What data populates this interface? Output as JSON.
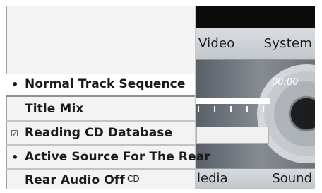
{
  "tabs_top": {
    "video": "Video",
    "system": "System"
  },
  "tabs_bottom": {
    "media": "ledia",
    "sound": "Sound"
  },
  "player": {
    "time": "00:00",
    "progress": 1.0
  },
  "menu": {
    "items": [
      {
        "marker": "•",
        "label": "Normal Track Sequence"
      },
      {
        "marker": "",
        "label": "Title Mix"
      },
      {
        "marker": "☑",
        "label": "Reading CD Database"
      },
      {
        "marker": "•",
        "label": "Active Source For The Rear"
      },
      {
        "marker": "",
        "label": "Rear Audio Off",
        "icon": "cd-rear-icon",
        "icon_glyph": "CD"
      }
    ]
  }
}
